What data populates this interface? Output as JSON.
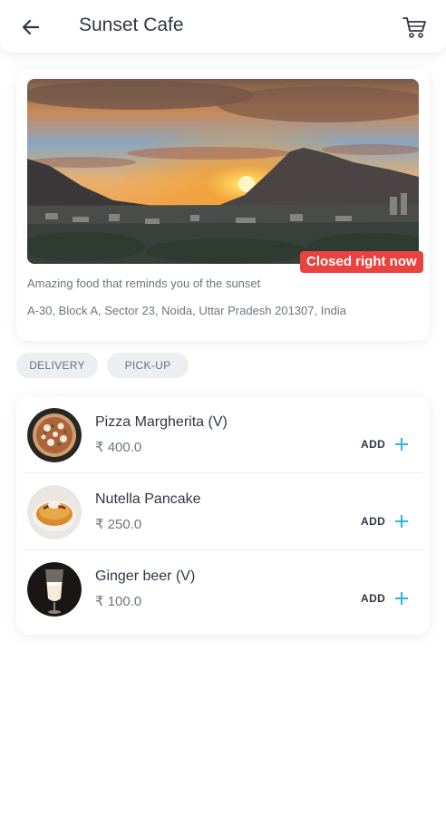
{
  "header": {
    "title": "Sunset Cafe",
    "back_icon": "arrow-left-icon",
    "cart_icon": "cart-icon"
  },
  "restaurant": {
    "status_badge": "Closed right now",
    "tagline": "Amazing food that reminds you of the sunset",
    "address": "A-30, Block A, Sector 23, Noida, Uttar Pradesh 201307, India"
  },
  "order_modes": [
    "DELIVERY",
    "PICK-UP"
  ],
  "menu": {
    "add_label": "ADD",
    "items": [
      {
        "name": "Pizza Margherita (V)",
        "price": "₹ 400.0"
      },
      {
        "name": "Nutella Pancake",
        "price": "₹ 250.0"
      },
      {
        "name": "Ginger beer (V)",
        "price": "₹ 100.0"
      }
    ]
  },
  "colors": {
    "accent": "#2bb7d9",
    "closed_badge": "#e8433f",
    "text_primary": "#2f3645",
    "text_secondary": "#6e7480",
    "chip_bg": "#eceef1"
  }
}
